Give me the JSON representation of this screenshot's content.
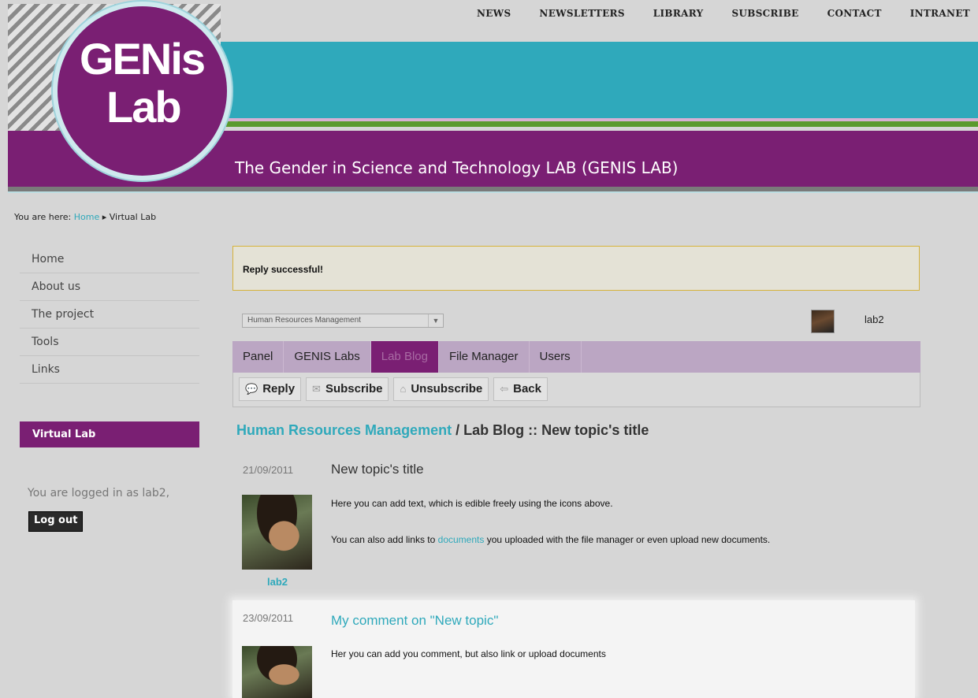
{
  "topnav": [
    "NEWS",
    "NEWSLETTERS",
    "LIBRARY",
    "SUBSCRIBE",
    "CONTACT",
    "INTRANET"
  ],
  "logo": {
    "line1": "GENis",
    "line2": "Lab"
  },
  "site_title": "The Gender in Science and Technology LAB (GENIS LAB)",
  "breadcrumb": {
    "prefix": "You are here:",
    "home": "Home",
    "sep": "▸",
    "current": "Virtual Lab"
  },
  "sidebar": {
    "menu": [
      "Home",
      "About us",
      "The project",
      "Tools",
      "Links"
    ],
    "section_title": "Virtual Lab",
    "logged_in_text": "You are logged in as lab2,",
    "logout_label": "Log out"
  },
  "message": "Reply successful!",
  "lab_select": {
    "value": "Human Resources Management"
  },
  "user": {
    "name": "lab2"
  },
  "tabs": [
    "Panel",
    "GENIS Labs",
    "Lab Blog",
    "File Manager",
    "Users"
  ],
  "actions": [
    {
      "icon": "reply-icon",
      "label": "Reply"
    },
    {
      "icon": "mail-icon",
      "label": "Subscribe"
    },
    {
      "icon": "open-mail-icon",
      "label": "Unsubscribe"
    },
    {
      "icon": "back-arrow-icon",
      "label": "Back"
    }
  ],
  "heading": {
    "lab": "Human Resources Management",
    "rest": " / Lab Blog :: New topic's title"
  },
  "post": {
    "date": "21/09/2011",
    "title": "New topic's title",
    "text1": "Here you can add text, which is edible freely using the icons above.",
    "text2_pre": "You can also add links to ",
    "text2_link": "documents",
    "text2_post": " you uploaded with the file manager or even upload new documents.",
    "author": "lab2"
  },
  "comment": {
    "date": "23/09/2011",
    "title": "My comment on \"New topic\"",
    "text": "Her you can add you comment, but also link or upload documents"
  },
  "colors": {
    "purple": "#7a1f73",
    "teal": "#2fa9bb",
    "green": "#5a9a2e",
    "tabbar": "#bba6c3"
  }
}
